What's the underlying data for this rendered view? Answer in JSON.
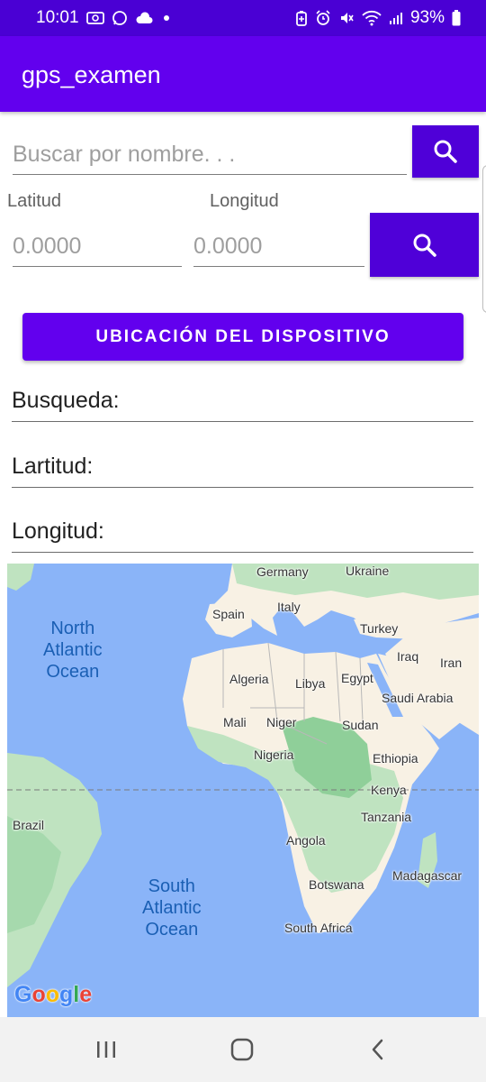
{
  "status_bar": {
    "time": "10:01",
    "battery": "93%",
    "left_icons": [
      "screenshot-icon",
      "whatsapp-icon",
      "cloud-icon",
      "dot-icon"
    ],
    "right_icons": [
      "battery-saver-icon",
      "alarm-icon",
      "mute-icon",
      "wifi-icon",
      "signal-icon",
      "battery-icon"
    ]
  },
  "app": {
    "title": "gps_examen"
  },
  "search": {
    "placeholder": "Buscar por nombre. . .",
    "button_icon": "search-icon"
  },
  "coords": {
    "lat_label": "Latitud",
    "lng_label": "Longitud",
    "lat_placeholder": "0.0000",
    "lng_placeholder": "0.0000",
    "button_icon": "search-icon"
  },
  "device_button": {
    "label": "UBICACIÓN DEL DISPOSITIVO"
  },
  "results": {
    "busqueda": "Busqueda:",
    "latitud": "Lartitud:",
    "longitud": "Longitud:"
  },
  "map": {
    "countries": [
      "Germany",
      "Ukraine",
      "Spain",
      "Italy",
      "Turkey",
      "Iraq",
      "Iran",
      "Algeria",
      "Libya",
      "Egypt",
      "Saudi Arabia",
      "Mali",
      "Niger",
      "Sudan",
      "Nigeria",
      "Ethiopia",
      "Kenya",
      "Brazil",
      "Tanzania",
      "Angola",
      "Madagascar",
      "Botswana",
      "South Africa"
    ],
    "oceans": [
      "North Atlantic Ocean",
      "South Atlantic Ocean"
    ],
    "logo": "Google",
    "colors": {
      "water": "#8ab4f8",
      "land": "#f8f1e4",
      "vegetation": "#bfe3c0"
    }
  },
  "colors": {
    "status_bar": "#4a00d4",
    "app_bar": "#6200ee",
    "button": "#4f00d8"
  },
  "nav_bar": {
    "icons": [
      "recents-icon",
      "home-icon",
      "back-icon"
    ]
  }
}
